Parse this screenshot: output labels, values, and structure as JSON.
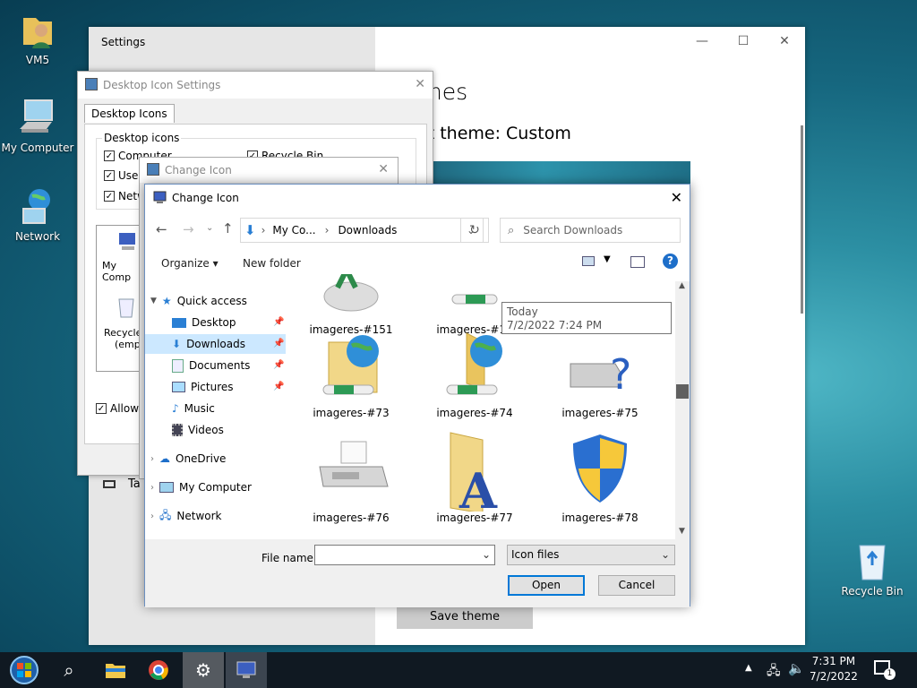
{
  "desktop": {
    "icons": [
      {
        "label": "VM5"
      },
      {
        "label": "My Computer"
      },
      {
        "label": "Network"
      },
      {
        "label": "Recycle Bin"
      }
    ]
  },
  "settings": {
    "title": "Settings",
    "heading": "emes",
    "current_theme": "ent theme: Custom",
    "taskbar_row": "Ta",
    "save_theme": "Save theme"
  },
  "desktop_icon_settings": {
    "title": "Desktop Icon Settings",
    "tab": "Desktop Icons",
    "group_label": "Desktop icons",
    "checkboxes": [
      {
        "label": "Computer",
        "checked": true
      },
      {
        "label": "Recycle Bin",
        "checked": true
      },
      {
        "label": "User",
        "checked": true
      },
      {
        "label": "Netw",
        "checked": true
      }
    ],
    "preview_labels": [
      "My Comp",
      "Recycle",
      "(empt"
    ],
    "allow_label": "Allow t"
  },
  "change_icon_small": {
    "title": "Change Icon"
  },
  "dialog": {
    "title": "Change Icon",
    "breadcrumb": [
      "My Co...",
      "Downloads"
    ],
    "search_placeholder": "Search Downloads",
    "organize": "Organize",
    "new_folder": "New folder",
    "tree": [
      {
        "label": "Quick access"
      },
      {
        "label": "Desktop"
      },
      {
        "label": "Downloads"
      },
      {
        "label": "Documents"
      },
      {
        "label": "Pictures"
      },
      {
        "label": "Music"
      },
      {
        "label": "Videos"
      },
      {
        "label": "OneDrive"
      },
      {
        "label": "My Computer"
      },
      {
        "label": "Network"
      }
    ],
    "files": [
      {
        "label": "imageres-#151"
      },
      {
        "label": "imageres-#15"
      },
      {
        "label": "imageres-#73"
      },
      {
        "label": "imageres-#74"
      },
      {
        "label": "imageres-#75"
      },
      {
        "label": "imageres-#76"
      },
      {
        "label": "imageres-#77"
      },
      {
        "label": "imageres-#78"
      }
    ],
    "tooltip": {
      "line1": "Today",
      "line2": "7/2/2022 7:24 PM"
    },
    "file_name_label": "File name:",
    "file_name_value": "",
    "file_type": "Icon files",
    "open": "Open",
    "cancel": "Cancel"
  },
  "taskbar": {
    "time": "7:31 PM",
    "date": "7/2/2022",
    "notification_count": "1"
  }
}
